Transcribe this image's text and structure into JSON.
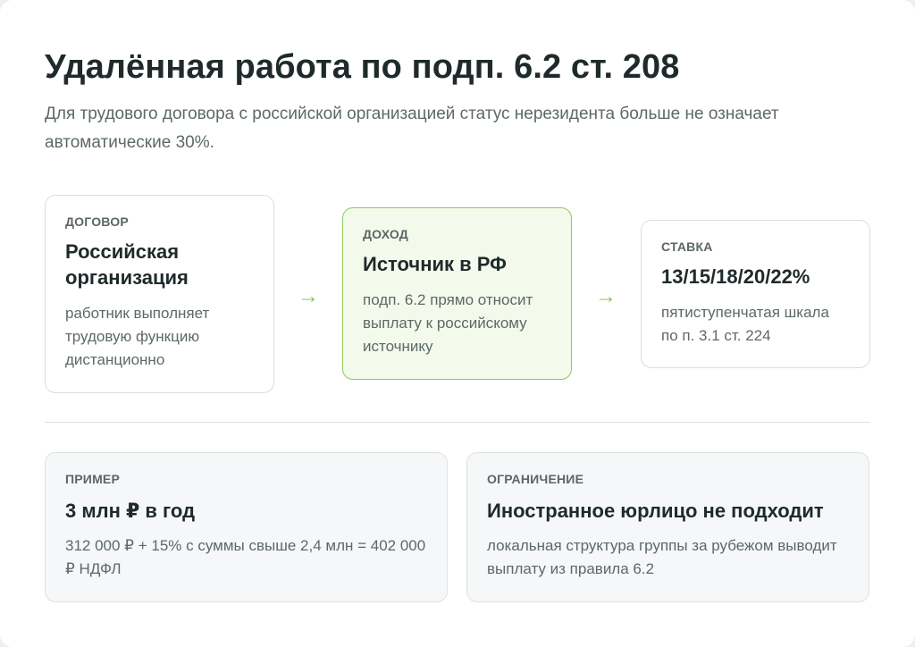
{
  "header": {
    "title": "Удалённая работа по подп. 6.2 ст. 208",
    "subtitle": "Для трудового договора с российской организацией статус нерезидента больше не означает автоматические 30%."
  },
  "flow": {
    "contract": {
      "label": "ДОГОВОР",
      "heading": "Российская организация",
      "text": "работник выполняет трудовую функцию дистанционно"
    },
    "income": {
      "label": "ДОХОД",
      "heading": "Источник в РФ",
      "text": "подп. 6.2 прямо относит выплату к российскому источнику"
    },
    "rate": {
      "label": "СТАВКА",
      "heading": "13/15/18/20/22%",
      "text": "пятиступенчатая шкала по п. 3.1 ст. 224"
    },
    "arrow_glyph": "→"
  },
  "example": {
    "label": "ПРИМЕР",
    "heading": "3 млн ₽ в год",
    "text": "312 000 ₽ + 15% с суммы свыше 2,4 млн = 402 000 ₽ НДФЛ"
  },
  "limitation": {
    "label": "ОГРАНИЧЕНИЕ",
    "heading": "Иностранное юрлицо не подходит",
    "text": "локальная структура группы за рубежом выводит выплату из правила 6.2"
  },
  "colors": {
    "accent_green": "#8cc95f",
    "highlight_bg": "#f3faeb",
    "title_text": "#1f2a2a",
    "muted_text": "#5d6868"
  }
}
